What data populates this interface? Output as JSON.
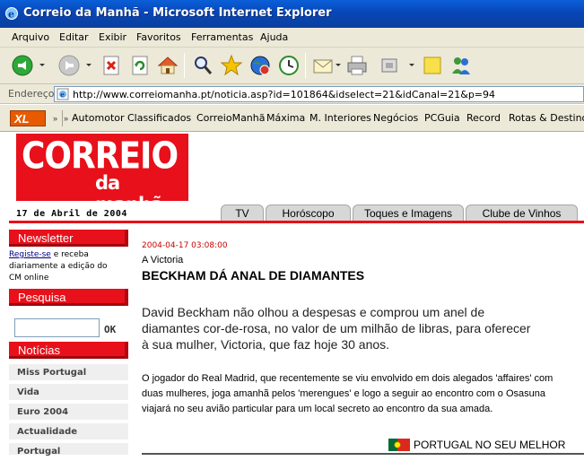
{
  "window": {
    "title": "Correio da Manhã - Microsoft Internet Explorer"
  },
  "menu": [
    "Arquivo",
    "Editar",
    "Exibir",
    "Favoritos",
    "Ferramentas",
    "Ajuda"
  ],
  "address": {
    "label": "Endereço",
    "url": "http://www.correiomanha.pt/noticia.asp?id=101864&idselect=21&idCanal=21&p=94"
  },
  "links": {
    "brand": "XL",
    "items": [
      "Automotor",
      "Classificados",
      "CorreioManhã",
      "Máxima",
      "M. Interiores",
      "Negócios",
      "PCGuia",
      "Record",
      "Rotas & Destinos"
    ]
  },
  "site": {
    "logo_top": "CORREIO",
    "logo_bottom": "da manhã",
    "date": "17 de Abril de 2004",
    "tabs": [
      "TV",
      "Horóscopo",
      "Toques e Imagens",
      "Clube de Vinhos"
    ],
    "brand_red": "#e8101a"
  },
  "sidebar": {
    "newsletter_title": "Newsletter",
    "newsletter_link": "Registe-se",
    "newsletter_text": " e receba diariamente a edição do CM online",
    "search_title": "Pesquisa",
    "search_value": "",
    "search_ok": "OK",
    "news_title": "Notícias",
    "news_items": [
      "Miss Portugal",
      "Vida",
      "Euro 2004",
      "Actualidade",
      "Portugal"
    ]
  },
  "article": {
    "datetime": "2004-04-17 03:08:00",
    "kicker": "A Victoria",
    "title": "BECKHAM DÁ ANAL DE DIAMANTES",
    "lead": "David Beckham não olhou a despesas e comprou um anel de diamantes cor-de-rosa, no valor de um milhão de libras, para oferecer à sua mulher, Victoria, que faz hoje 30 anos.",
    "body": "O jogador do Real Madrid, que recentemente se viu envolvido em dois alegados 'affaires' com duas mulheres, joga amanhã pelos 'merengues' e logo a seguir ao encontro com o Osasuna viajará no seu avião particular para um local secreto ao encontro da sua amada."
  },
  "footer": {
    "slogan": "PORTUGAL NO SEU MELHOR"
  }
}
